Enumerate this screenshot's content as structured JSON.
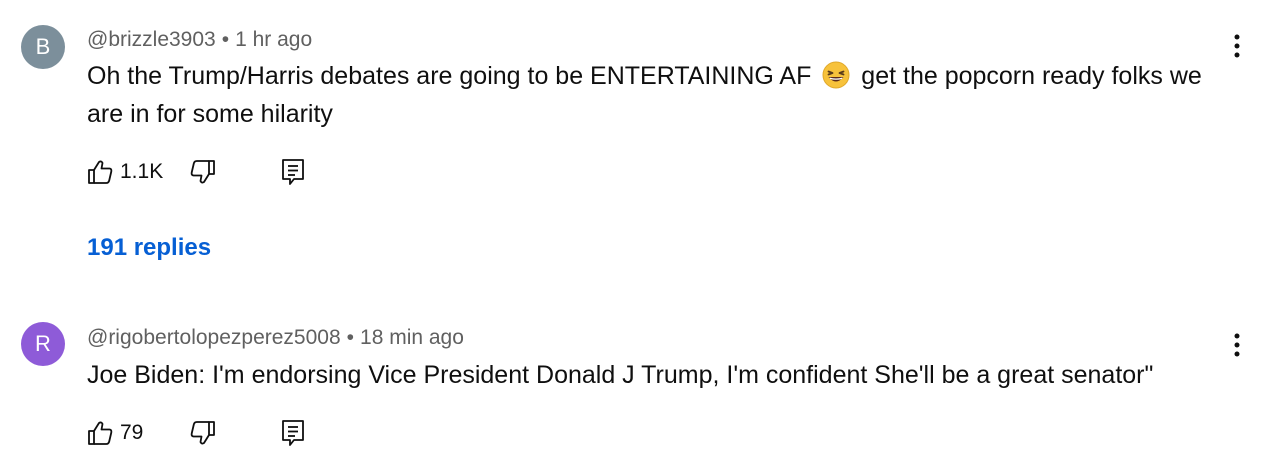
{
  "colors": {
    "avatar_b": "#7c8f9b",
    "avatar_r": "#8e5bd8",
    "link": "#065fd4",
    "meta": "#606060",
    "text": "#0f0f0f"
  },
  "comments": [
    {
      "avatar_letter": "B",
      "handle": "@brizzle3903",
      "separator": "•",
      "time": "1 hr ago",
      "text_before_emoji": "Oh the Trump/Harris debates are going to be ENTERTAINING AF",
      "emoji": "grinning-squinting-face",
      "text_after_emoji": "get the popcorn ready folks we are in for some hilarity",
      "likes": "1.1K",
      "replies_label": "191 replies"
    },
    {
      "avatar_letter": "R",
      "handle": "@rigobertolopezperez5008",
      "separator": "•",
      "time": "18 min ago",
      "text": "Joe Biden: I'm endorsing Vice President Donald  J Trump, I'm confident She'll be a great senator\"",
      "likes": "79"
    }
  ],
  "icons": {
    "menu": "more-vert-icon",
    "like": "thumb-up-icon",
    "dislike": "thumb-down-icon",
    "reply": "reply-icon"
  }
}
